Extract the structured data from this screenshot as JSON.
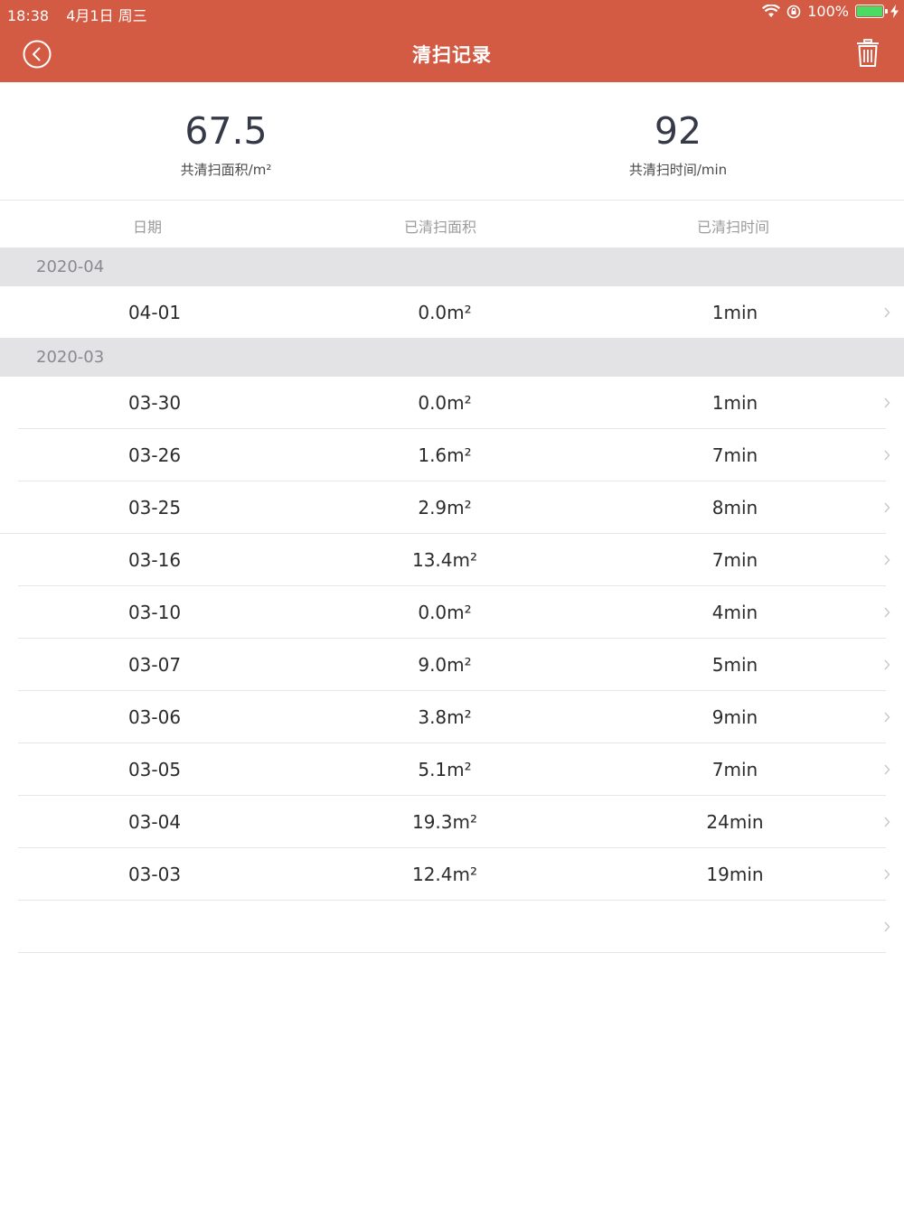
{
  "status_bar": {
    "time": "18:38",
    "date": "4月1日 周三",
    "battery": "100%"
  },
  "nav": {
    "title": "清扫记录"
  },
  "summary": {
    "area_value": "67.5",
    "area_label": "共清扫面积/m²",
    "time_value": "92",
    "time_label": "共清扫时间/min"
  },
  "columns": {
    "date": "日期",
    "area": "已清扫面积",
    "time": "已清扫时间"
  },
  "groups": [
    {
      "label": "2020-04",
      "rows": [
        {
          "date": "04-01",
          "area": "0.0m²",
          "time": "1min"
        }
      ]
    },
    {
      "label": "2020-03",
      "rows": [
        {
          "date": "03-30",
          "area": "0.0m²",
          "time": "1min"
        },
        {
          "date": "03-26",
          "area": "1.6m²",
          "time": "7min"
        },
        {
          "date": "03-25",
          "area": "2.9m²",
          "time": "8min"
        },
        {
          "date": "03-16",
          "area": "13.4m²",
          "time": "7min"
        },
        {
          "date": "03-10",
          "area": "0.0m²",
          "time": "4min"
        },
        {
          "date": "03-07",
          "area": "9.0m²",
          "time": "5min"
        },
        {
          "date": "03-06",
          "area": "3.8m²",
          "time": "9min"
        },
        {
          "date": "03-05",
          "area": "5.1m²",
          "time": "7min"
        },
        {
          "date": "03-04",
          "area": "19.3m²",
          "time": "24min"
        },
        {
          "date": "03-03",
          "area": "12.4m²",
          "time": "19min"
        }
      ]
    }
  ],
  "icons": {
    "back": "back-circle-icon",
    "delete": "trash-icon",
    "row_chevron": "chevron-right-icon"
  },
  "colors": {
    "accent": "#d35b44",
    "battery": "#4cd964",
    "group_bg": "#e3e3e6"
  }
}
